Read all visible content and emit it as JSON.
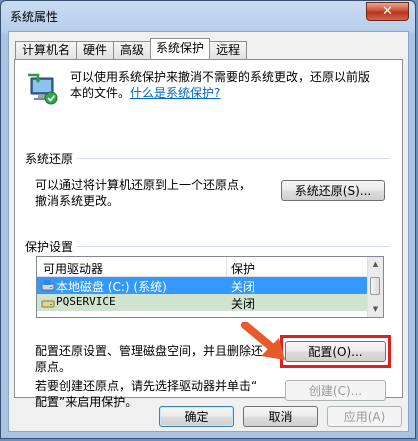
{
  "window": {
    "title": "系统属性",
    "close_label": "✕"
  },
  "tabs": [
    {
      "label": "计算机名"
    },
    {
      "label": "硬件"
    },
    {
      "label": "高级"
    },
    {
      "label": "系统保护"
    },
    {
      "label": "远程"
    }
  ],
  "intro": {
    "line1": "可以使用系统保护来撤消不需要的系统更改，还原以前版",
    "line2": "本的文件。",
    "link": "什么是系统保护?"
  },
  "restore": {
    "group_title": "系统还原",
    "line1": "可以通过将计算机还原到上一个还原点，",
    "line2": "撤消系统更改。",
    "button": "系统还原(S)..."
  },
  "protection": {
    "group_title": "保护设置",
    "columns": [
      "可用驱动器",
      "保护"
    ],
    "rows": [
      {
        "drive": "本地磁盘 (C:) (系统)",
        "protect": "关闭"
      },
      {
        "drive": "PQSERVICE",
        "protect": "关闭"
      }
    ],
    "config_text": "配置还原设置、管理磁盘空间，并且删除还",
    "config_text2": "原点。",
    "config_button": "配置(O)...",
    "create_text1": "若要创建还原点，请先选择驱动器并单击“",
    "create_text2": "配置”来启用保护。",
    "create_button": "创建(C)..."
  },
  "footer": {
    "ok": "确定",
    "cancel": "取消",
    "apply": "应用(A)"
  }
}
